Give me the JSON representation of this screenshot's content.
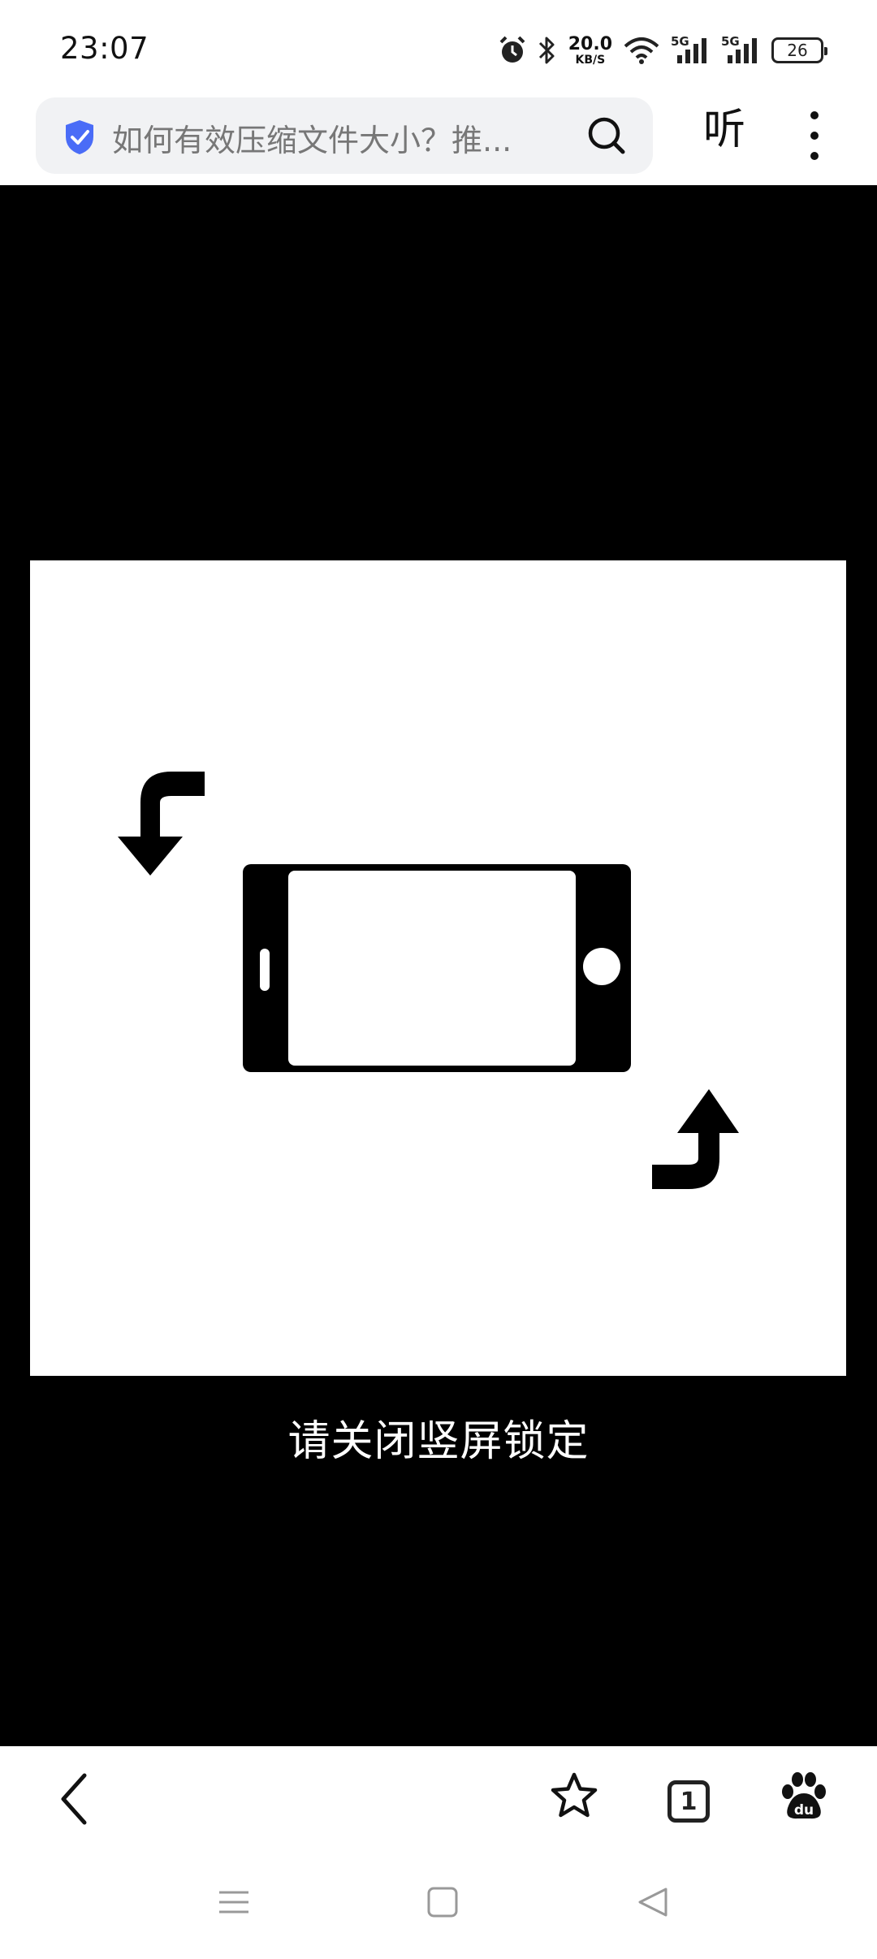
{
  "status_bar": {
    "time": "23:07",
    "net_speed_value": "20.0",
    "net_speed_unit": "KB/S",
    "signal_1_label": "5G",
    "signal_2_label": "5G",
    "battery_level": "26",
    "icons": [
      "alarm-icon",
      "bluetooth-icon",
      "wifi-icon",
      "signal-5g-icon",
      "signal-5g-icon",
      "battery-icon"
    ]
  },
  "browser": {
    "address_text": "如何有效压缩文件大小？推...",
    "listen_label": "听",
    "icons": [
      "shield-check-icon",
      "search-icon",
      "more-vertical-icon"
    ]
  },
  "content": {
    "rotate_message": "请关闭竖屏锁定",
    "illustration": "rotate-phone-icon"
  },
  "bottom_nav": {
    "tab_count": "1",
    "icons": [
      "back-chevron-icon",
      "star-icon",
      "tabs-icon",
      "baidu-paw-icon"
    ]
  },
  "system_nav": {
    "icons": [
      "menu-icon",
      "home-square-icon",
      "back-triangle-icon"
    ]
  },
  "colors": {
    "accent_shield": "#4a6cf7",
    "video_background": "#000000",
    "card_background": "#ffffff"
  }
}
